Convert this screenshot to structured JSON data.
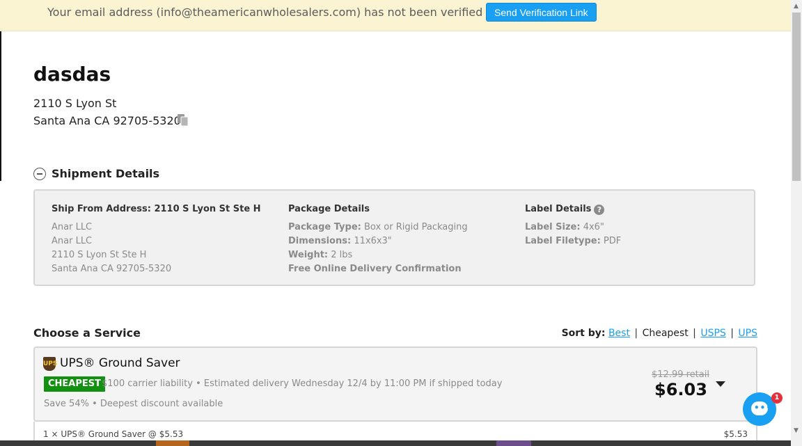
{
  "banner": {
    "message": "Your email address (info@theamericanwholesalers.com) has not been verified yet!",
    "button_label": "Send Verification Link"
  },
  "recipient": {
    "name": "dasdas",
    "address_line1": "2110 S Lyon St",
    "address_line2": "Santa Ana CA 92705-5320",
    "copy_icon": "copy-icon"
  },
  "shipment": {
    "section_title": "Shipment Details",
    "ship_from": {
      "heading": "Ship From Address: 2110 S Lyon St Ste H",
      "lines": [
        "Anar LLC",
        "Anar LLC",
        "2110 S Lyon St Ste H",
        "Santa Ana CA 92705-5320"
      ]
    },
    "package": {
      "heading": "Package Details",
      "type_label": "Package Type:",
      "type_value": "Box or Rigid Packaging",
      "dimensions_label": "Dimensions:",
      "dimensions_value": "11x6x3\"",
      "weight_label": "Weight:",
      "weight_value": "2 lbs",
      "confirmation": "Free Online Delivery Confirmation"
    },
    "label": {
      "heading": "Label Details",
      "help": "?",
      "size_label": "Label Size:",
      "size_value": "4x6\"",
      "filetype_label": "Label Filetype:",
      "filetype_value": "PDF"
    }
  },
  "services": {
    "title": "Choose a Service",
    "sort_label": "Sort by:",
    "sort_best": "Best",
    "sort_cheapest": "Cheapest",
    "sort_usps": "USPS",
    "sort_ups": "UPS",
    "sep": "|"
  },
  "service_card": {
    "name": "UPS® Ground Saver",
    "carrier_icon": "UPS",
    "badge": "CHEAPEST",
    "description": "$100 carrier liability • Estimated delivery Wednesday 12/4 by 11:00 PM if shipped today",
    "savings": "Save 54% • Deepest discount available",
    "retail": "$12.99 retail",
    "price": "$6.03"
  },
  "line_item": {
    "label": "1 × UPS® Ground Saver @ $5.53",
    "value": "$5.53"
  },
  "chat": {
    "badge_count": "1"
  },
  "colors": {
    "accent": "#1aa0f2",
    "banner_bg": "#fbf4d3",
    "badge_green": "#11910f",
    "chat_badge": "#e5303a"
  }
}
